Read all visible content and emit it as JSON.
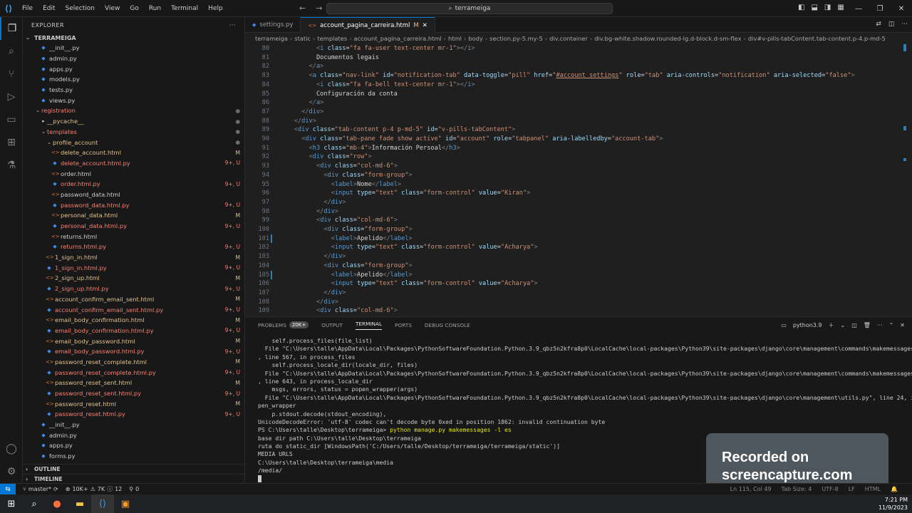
{
  "titlebar": {
    "menu": [
      "File",
      "Edit",
      "Selection",
      "View",
      "Go",
      "Run",
      "Terminal",
      "Help"
    ],
    "search": "terrameiga"
  },
  "sidebar": {
    "header": "EXPLORER",
    "root": "TERRAMEIGA",
    "items": [
      {
        "name": "__init__.py",
        "indent": 2,
        "type": "py",
        "color": "white",
        "badge": ""
      },
      {
        "name": "admin.py",
        "indent": 2,
        "type": "py",
        "color": "white",
        "badge": ""
      },
      {
        "name": "apps.py",
        "indent": 2,
        "type": "py",
        "color": "white",
        "badge": ""
      },
      {
        "name": "models.py",
        "indent": 2,
        "type": "py",
        "color": "white",
        "badge": ""
      },
      {
        "name": "tests.py",
        "indent": 2,
        "type": "py",
        "color": "white",
        "badge": ""
      },
      {
        "name": "views.py",
        "indent": 2,
        "type": "py",
        "color": "white",
        "badge": ""
      },
      {
        "name": "registration",
        "indent": 1,
        "type": "folder-open",
        "color": "err",
        "badge": "●"
      },
      {
        "name": "__pycache__",
        "indent": 2,
        "type": "folder",
        "color": "mod",
        "badge": "●"
      },
      {
        "name": "templates",
        "indent": 2,
        "type": "folder-open",
        "color": "err",
        "badge": "●"
      },
      {
        "name": "profile_account",
        "indent": 3,
        "type": "folder-open",
        "color": "mod",
        "badge": "●"
      },
      {
        "name": "delete_account.html",
        "indent": 4,
        "type": "html",
        "color": "mod",
        "badge": "M"
      },
      {
        "name": "delete_account.html.py",
        "indent": 4,
        "type": "py",
        "color": "err",
        "badge": "9+, U"
      },
      {
        "name": "order.html",
        "indent": 4,
        "type": "html",
        "color": "white",
        "badge": ""
      },
      {
        "name": "order.html.py",
        "indent": 4,
        "type": "py",
        "color": "err",
        "badge": "9+, U"
      },
      {
        "name": "password_data.html",
        "indent": 4,
        "type": "html",
        "color": "white",
        "badge": ""
      },
      {
        "name": "password_data.html.py",
        "indent": 4,
        "type": "py",
        "color": "err",
        "badge": "9+, U"
      },
      {
        "name": "personal_data.html",
        "indent": 4,
        "type": "html",
        "color": "mod",
        "badge": "M"
      },
      {
        "name": "personal_data.html.py",
        "indent": 4,
        "type": "py",
        "color": "err",
        "badge": "9+, U"
      },
      {
        "name": "returns.html",
        "indent": 4,
        "type": "html",
        "color": "white",
        "badge": ""
      },
      {
        "name": "returns.html.py",
        "indent": 4,
        "type": "py",
        "color": "err",
        "badge": "9+, U"
      },
      {
        "name": "1_sign_in.html",
        "indent": 3,
        "type": "html",
        "color": "mod",
        "badge": "M"
      },
      {
        "name": "1_sign_in.html.py",
        "indent": 3,
        "type": "py",
        "color": "err",
        "badge": "9+, U"
      },
      {
        "name": "2_sign_up.html",
        "indent": 3,
        "type": "html",
        "color": "mod",
        "badge": "M"
      },
      {
        "name": "2_sign_up.html.py",
        "indent": 3,
        "type": "py",
        "color": "err",
        "badge": "9+, U"
      },
      {
        "name": "account_confirm_email_sent.html",
        "indent": 3,
        "type": "html",
        "color": "mod",
        "badge": "M"
      },
      {
        "name": "account_confirm_email_sent.html.py",
        "indent": 3,
        "type": "py",
        "color": "err",
        "badge": "9+, U"
      },
      {
        "name": "email_body_confirmation.html",
        "indent": 3,
        "type": "html",
        "color": "mod",
        "badge": "M"
      },
      {
        "name": "email_body_confirmation.html.py",
        "indent": 3,
        "type": "py",
        "color": "err",
        "badge": "9+, U"
      },
      {
        "name": "email_body_password.html",
        "indent": 3,
        "type": "html",
        "color": "mod",
        "badge": "M"
      },
      {
        "name": "email_body_password.html.py",
        "indent": 3,
        "type": "py",
        "color": "err",
        "badge": "9+, U"
      },
      {
        "name": "password_reset_complete.html",
        "indent": 3,
        "type": "html",
        "color": "mod",
        "badge": "M"
      },
      {
        "name": "password_reset_complete.html.py",
        "indent": 3,
        "type": "py",
        "color": "err",
        "badge": "9+, U"
      },
      {
        "name": "password_reset_sent.html",
        "indent": 3,
        "type": "html",
        "color": "mod",
        "badge": "M"
      },
      {
        "name": "password_reset_sent.html.py",
        "indent": 3,
        "type": "py",
        "color": "err",
        "badge": "9+, U"
      },
      {
        "name": "password_reset.html",
        "indent": 3,
        "type": "html",
        "color": "mod",
        "badge": "M"
      },
      {
        "name": "password_reset.html.py",
        "indent": 3,
        "type": "py",
        "color": "err",
        "badge": "9+, U"
      },
      {
        "name": "__init__.py",
        "indent": 2,
        "type": "py",
        "color": "white",
        "badge": ""
      },
      {
        "name": "admin.py",
        "indent": 2,
        "type": "py",
        "color": "white",
        "badge": ""
      },
      {
        "name": "apps.py",
        "indent": 2,
        "type": "py",
        "color": "white",
        "badge": ""
      },
      {
        "name": "forms.py",
        "indent": 2,
        "type": "py",
        "color": "white",
        "badge": ""
      }
    ],
    "outline": "OUTLINE",
    "timeline": "TIMELINE"
  },
  "tabs": [
    {
      "label": "settings.py",
      "type": "py",
      "active": false,
      "suffix": ""
    },
    {
      "label": "account_pagina_carreira.html",
      "type": "html",
      "active": true,
      "suffix": "M"
    }
  ],
  "breadcrumb": [
    "terrameiga",
    "static",
    "templates",
    "account_pagina_carreira.html",
    "html",
    "body",
    "section.py-5.my-5",
    "div.container",
    "div.bg-white.shadow.rounded-lg.d-block.d-sm-flex",
    "div#v-pills-tabContent.tab-content.p-4.p-md-5"
  ],
  "editor": {
    "lines": [
      {
        "n": "80",
        "indent": 10,
        "html": "<span class='t-punct'>&lt;</span><span class='t-tag'>i</span> <span class='t-attr'>class</span>=<span class='t-str'>\"fa fa-user text-center mr-1\"</span><span class='t-punct'>&gt;&lt;/</span><span class='t-tag'>i</span><span class='t-punct'>&gt;</span>"
      },
      {
        "n": "81",
        "indent": 10,
        "html": "<span class='t-text'>Documentos legais</span>"
      },
      {
        "n": "82",
        "indent": 8,
        "html": "<span class='t-punct'>&lt;/</span><span class='t-tag'>a</span><span class='t-punct'>&gt;</span>"
      },
      {
        "n": "83",
        "indent": 8,
        "html": "<span class='t-punct'>&lt;</span><span class='t-tag'>a</span> <span class='t-attr'>class</span>=<span class='t-str'>\"nav-link\"</span> <span class='t-attr'>id</span>=<span class='t-str'>\"notification-tab\"</span> <span class='t-attr'>data-toggle</span>=<span class='t-str'>\"pill\"</span> <span class='t-attr'>href</span>=<span class='t-str'>\"</span><span class='t-link'>#account_settings</span><span class='t-str'>\"</span> <span class='t-attr'>role</span>=<span class='t-str'>\"tab\"</span> <span class='t-attr'>aria-controls</span>=<span class='t-str'>\"notification\"</span> <span class='t-attr'>aria-selected</span>=<span class='t-str'>\"false\"</span><span class='t-punct'>&gt;</span>"
      },
      {
        "n": "84",
        "indent": 10,
        "html": "<span class='t-punct'>&lt;</span><span class='t-tag'>i</span> <span class='t-attr'>class</span>=<span class='t-str'>\"fa fa-bell text-center mr-1\"</span><span class='t-punct'>&gt;&lt;/</span><span class='t-tag'>i</span><span class='t-punct'>&gt;</span>"
      },
      {
        "n": "85",
        "indent": 10,
        "html": "<span class='t-text'>Configuración da conta</span>"
      },
      {
        "n": "86",
        "indent": 8,
        "html": "<span class='t-punct'>&lt;/</span><span class='t-tag'>a</span><span class='t-punct'>&gt;</span>"
      },
      {
        "n": "87",
        "indent": 6,
        "html": "<span class='t-punct'>&lt;/</span><span class='t-tag'>div</span><span class='t-punct'>&gt;</span>"
      },
      {
        "n": "88",
        "indent": 4,
        "html": "<span class='t-punct'>&lt;/</span><span class='t-tag'>div</span><span class='t-punct'>&gt;</span>"
      },
      {
        "n": "89",
        "indent": 4,
        "html": "<span class='t-punct'>&lt;</span><span class='t-tag'>div</span> <span class='t-attr'>class</span>=<span class='t-str'>\"tab-content p-4 p-md-5\"</span> <span class='t-attr'>id</span>=<span class='t-str'>\"v-pills-tabContent\"</span><span class='t-punct'>&gt;</span>"
      },
      {
        "n": "90",
        "indent": 6,
        "html": "<span class='t-punct'>&lt;</span><span class='t-tag'>div</span> <span class='t-attr'>class</span>=<span class='t-str'>\"tab-pane fade show active\"</span> <span class='t-attr'>id</span>=<span class='t-str'>\"account\"</span> <span class='t-attr'>role</span>=<span class='t-str'>\"tabpanel\"</span> <span class='t-attr'>aria-labelledby</span>=<span class='t-str'>\"account-tab\"</span><span class='t-punct'>&gt;</span>"
      },
      {
        "n": "91",
        "indent": 8,
        "html": "<span class='t-punct'>&lt;</span><span class='t-tag'>h3</span> <span class='t-attr'>class</span>=<span class='t-str'>\"mb-4\"</span><span class='t-punct'>&gt;</span><span class='t-text'>Información Persoal</span><span class='t-punct'>&lt;/</span><span class='t-tag'>h3</span><span class='t-punct'>&gt;</span>"
      },
      {
        "n": "92",
        "indent": 8,
        "html": "<span class='t-punct'>&lt;</span><span class='t-tag'>div</span> <span class='t-attr'>class</span>=<span class='t-str'>\"row\"</span><span class='t-punct'>&gt;</span>"
      },
      {
        "n": "93",
        "indent": 10,
        "html": "<span class='t-punct'>&lt;</span><span class='t-tag'>div</span> <span class='t-attr'>class</span>=<span class='t-str'>\"col-md-6\"</span><span class='t-punct'>&gt;</span>"
      },
      {
        "n": "94",
        "indent": 12,
        "html": "<span class='t-punct'>&lt;</span><span class='t-tag'>div</span> <span class='t-attr'>class</span>=<span class='t-str'>\"form-group\"</span><span class='t-punct'>&gt;</span>"
      },
      {
        "n": "95",
        "indent": 14,
        "html": "<span class='t-punct'>&lt;</span><span class='t-tag'>label</span><span class='t-punct'>&gt;</span><span class='t-text'>Nome</span><span class='t-punct'>&lt;/</span><span class='t-tag'>label</span><span class='t-punct'>&gt;</span>"
      },
      {
        "n": "96",
        "indent": 14,
        "html": "<span class='t-punct'>&lt;</span><span class='t-tag'>input</span> <span class='t-attr'>type</span>=<span class='t-str'>\"text\"</span> <span class='t-attr'>class</span>=<span class='t-str'>\"form-control\"</span> <span class='t-attr'>value</span>=<span class='t-str'>\"Kiran\"</span><span class='t-punct'>&gt;</span>"
      },
      {
        "n": "97",
        "indent": 12,
        "html": "<span class='t-punct'>&lt;/</span><span class='t-tag'>div</span><span class='t-punct'>&gt;</span>"
      },
      {
        "n": "98",
        "indent": 10,
        "html": "<span class='t-punct'>&lt;/</span><span class='t-tag'>div</span><span class='t-punct'>&gt;</span>"
      },
      {
        "n": "99",
        "indent": 10,
        "html": "<span class='t-punct'>&lt;</span><span class='t-tag'>div</span> <span class='t-attr'>class</span>=<span class='t-str'>\"col-md-6\"</span><span class='t-punct'>&gt;</span>"
      },
      {
        "n": "100",
        "indent": 12,
        "html": "<span class='t-punct'>&lt;</span><span class='t-tag'>div</span> <span class='t-attr'>class</span>=<span class='t-str'>\"form-group\"</span><span class='t-punct'>&gt;</span>"
      },
      {
        "n": "101",
        "indent": 14,
        "mark": true,
        "html": "<span class='t-punct'>&lt;</span><span class='t-tag'>label</span><span class='t-punct'>&gt;</span><span class='t-text'>Apelido</span><span class='t-punct'>&lt;/</span><span class='t-tag'>label</span><span class='t-punct'>&gt;</span>"
      },
      {
        "n": "102",
        "indent": 14,
        "html": "<span class='t-punct'>&lt;</span><span class='t-tag'>input</span> <span class='t-attr'>type</span>=<span class='t-str'>\"text\"</span> <span class='t-attr'>class</span>=<span class='t-str'>\"form-control\"</span> <span class='t-attr'>value</span>=<span class='t-str'>\"Acharya\"</span><span class='t-punct'>&gt;</span>"
      },
      {
        "n": "103",
        "indent": 12,
        "html": "<span class='t-punct'>&lt;/</span><span class='t-tag'>div</span><span class='t-punct'>&gt;</span>"
      },
      {
        "n": "104",
        "indent": 12,
        "html": "<span class='t-punct'>&lt;</span><span class='t-tag'>div</span> <span class='t-attr'>class</span>=<span class='t-str'>\"form-group\"</span><span class='t-punct'>&gt;</span>"
      },
      {
        "n": "105",
        "indent": 14,
        "mark": true,
        "html": "<span class='t-punct'>&lt;</span><span class='t-tag'>label</span><span class='t-punct'>&gt;</span><span class='t-text'>Apelido</span><span class='t-punct'>&lt;/</span><span class='t-tag'>label</span><span class='t-punct'>&gt;</span>"
      },
      {
        "n": "106",
        "indent": 14,
        "html": "<span class='t-punct'>&lt;</span><span class='t-tag'>input</span> <span class='t-attr'>type</span>=<span class='t-str'>\"text\"</span> <span class='t-attr'>class</span>=<span class='t-str'>\"form-control\"</span> <span class='t-attr'>value</span>=<span class='t-str'>\"Acharya\"</span><span class='t-punct'>&gt;</span>"
      },
      {
        "n": "107",
        "indent": 12,
        "html": "<span class='t-punct'>&lt;/</span><span class='t-tag'>div</span><span class='t-punct'>&gt;</span>"
      },
      {
        "n": "108",
        "indent": 10,
        "html": "<span class='t-punct'>&lt;/</span><span class='t-tag'>div</span><span class='t-punct'>&gt;</span>"
      },
      {
        "n": "109",
        "indent": 10,
        "html": "<span class='t-punct'>&lt;</span><span class='t-tag'>div</span> <span class='t-attr'>class</span>=<span class='t-str'>\"col-md-6\"</span><span class='t-punct'>&gt;</span>"
      }
    ]
  },
  "panel": {
    "tabs": [
      "PROBLEMS",
      "20K+",
      "OUTPUT",
      "TERMINAL",
      "PORTS",
      "DEBUG CONSOLE"
    ],
    "shell": "python3.9",
    "terminal_lines": [
      {
        "text": "    self.process_files(file_list)",
        "cmd": false
      },
      {
        "text": "  File \"C:\\Users\\talle\\AppData\\Local\\Packages\\PythonSoftwareFoundation.Python.3.9_qbz5n2kfra8p0\\LocalCache\\local-packages\\Python39\\site-packages\\django\\core\\management\\commands\\makemessages.py\"",
        "cmd": false
      },
      {
        "text": ", line 567, in process_files",
        "cmd": false
      },
      {
        "text": "    self.process_locale_dir(locale_dir, files)",
        "cmd": false
      },
      {
        "text": "  File \"C:\\Users\\talle\\AppData\\Local\\Packages\\PythonSoftwareFoundation.Python.3.9_qbz5n2kfra8p0\\LocalCache\\local-packages\\Python39\\site-packages\\django\\core\\management\\commands\\makemessages.py\"",
        "cmd": false
      },
      {
        "text": ", line 643, in process_locale_dir",
        "cmd": false
      },
      {
        "text": "    msgs, errors, status = popen_wrapper(args)",
        "cmd": false
      },
      {
        "text": "  File \"C:\\Users\\talle\\AppData\\Local\\Packages\\PythonSoftwareFoundation.Python.3.9_qbz5n2kfra8p0\\LocalCache\\local-packages\\Python39\\site-packages\\django\\core\\management\\utils.py\", line 24, in po",
        "cmd": false
      },
      {
        "text": "pen_wrapper",
        "cmd": false
      },
      {
        "text": "    p.stdout.decode(stdout_encoding),",
        "cmd": false
      },
      {
        "text": "UnicodeDecodeError: 'utf-8' codec can't decode byte 0xed in position 1862: invalid continuation byte",
        "cmd": false
      },
      {
        "text": "PS C:\\Users\\talle\\Desktop\\terrameiga> ",
        "cmd": true,
        "cmdtext": "python manage.py makemessages -l es"
      },
      {
        "text": "base dir path C:\\Users\\talle\\Desktop\\terrameiga",
        "cmd": false
      },
      {
        "text": "ruta do static_dir [WindowsPath('C:/Users/talle/Desktop/terrameiga/terrameiga/static')]",
        "cmd": false
      },
      {
        "text": "MEDIA URLS",
        "cmd": false
      },
      {
        "text": "C:\\Users\\talle\\Desktop\\terrameiga\\media",
        "cmd": false
      },
      {
        "text": "/media/",
        "cmd": false
      }
    ]
  },
  "watermark": {
    "line1": "Recorded on",
    "line2": "screencapture.com"
  },
  "statusbar": {
    "branch": "master*",
    "errors": "10K+",
    "warnings": "7K",
    "infos": "12",
    "ports": "0",
    "position": "Ln 115, Col 49",
    "tabsize": "Tab Size: 4",
    "encoding": "UTF-8",
    "eol": "LF",
    "language": "HTML"
  },
  "taskbar": {
    "time": "7:21 PM",
    "date": "11/9/2023"
  }
}
